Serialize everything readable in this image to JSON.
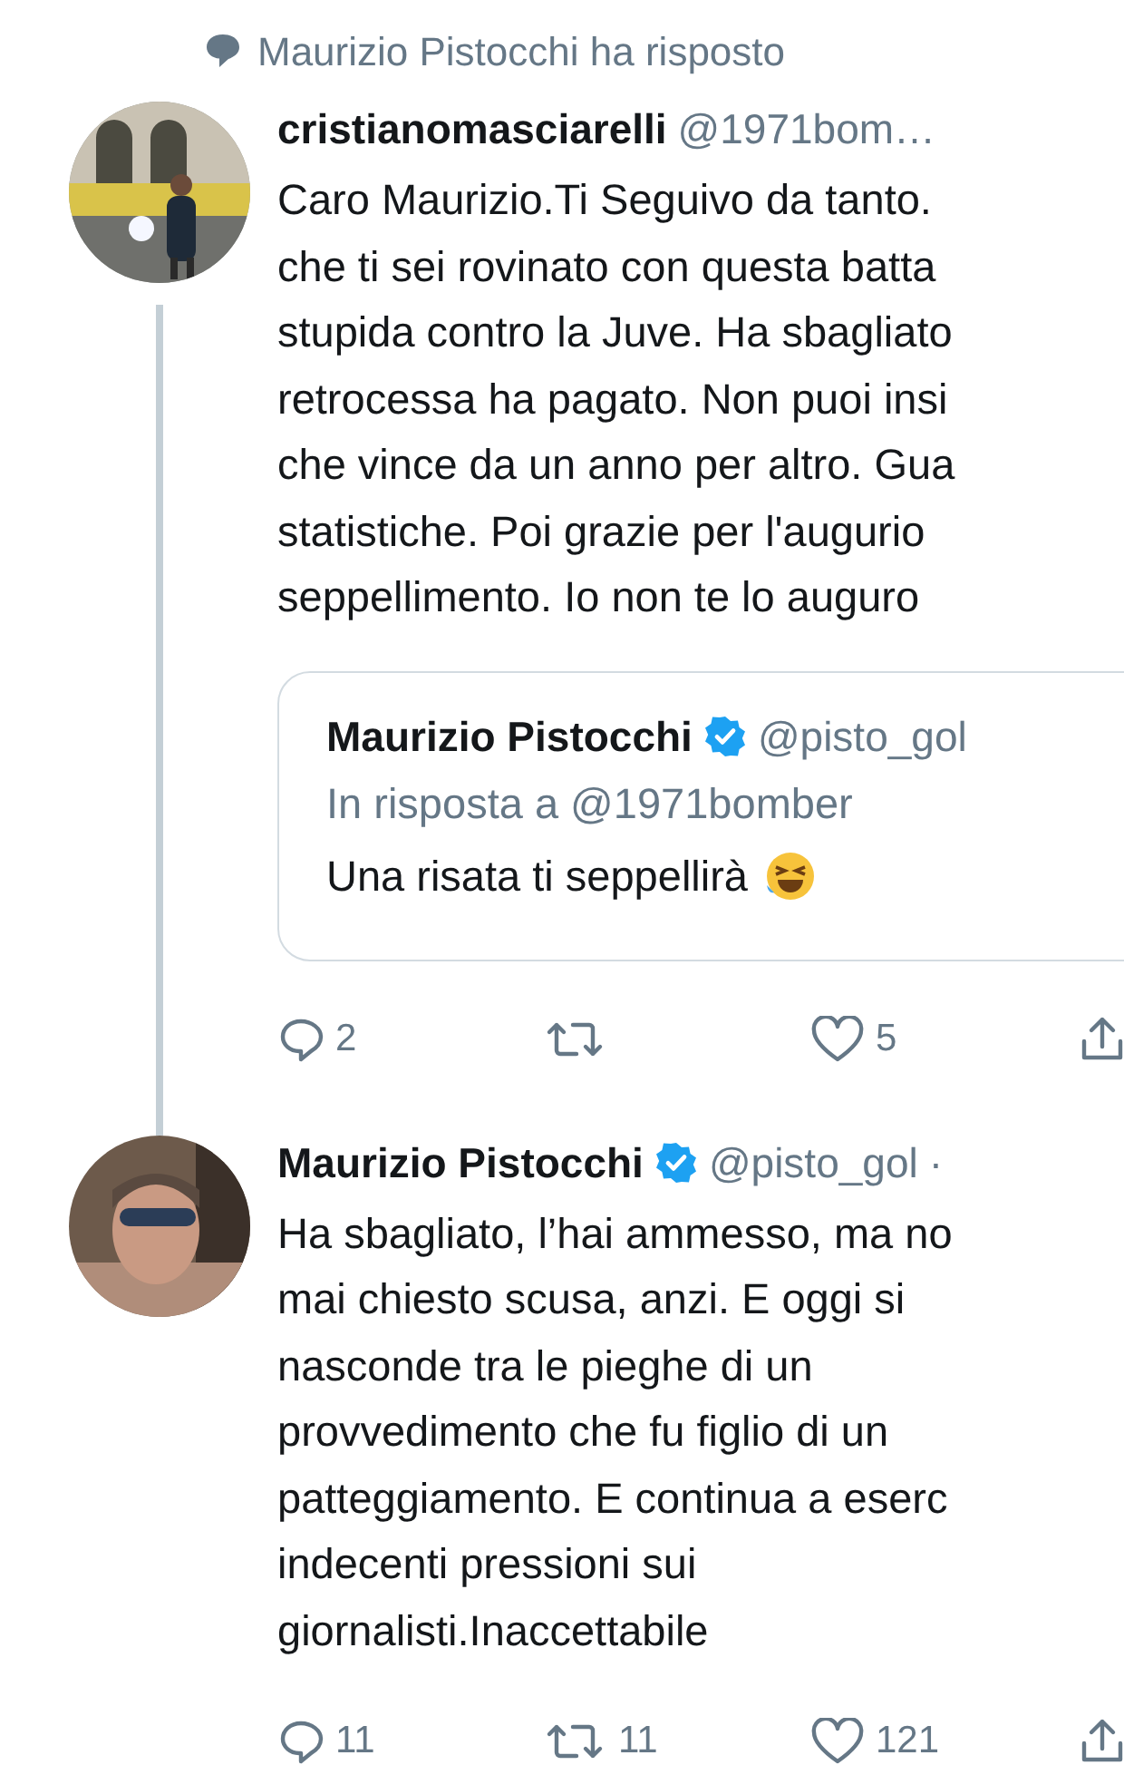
{
  "notification": {
    "text": "Maurizio Pistocchi ha risposto"
  },
  "tweets": [
    {
      "name": "cristianomasciarelli",
      "verified": false,
      "handle": "@1971bom…",
      "thread": true,
      "text": "Caro Maurizio.Ti Seguivo da tanto.\nche ti sei rovinato con questa batta\nstupida contro la Juve. Ha sbagliato\nretrocessa ha pagato. Non puoi insi\nche vince da un anno per altro. Gua\nstatistiche. Poi grazie per l'augurio\nseppellimento. Io non te lo auguro",
      "quote": {
        "name": "Maurizio Pistocchi",
        "verified": true,
        "handle": "@pisto_gol",
        "reply_to": "In risposta a @1971bomber",
        "text": "Una risata ti seppellirà"
      },
      "actions": [
        {
          "kind": "reply",
          "count": "2"
        },
        {
          "kind": "retweet"
        },
        {
          "kind": "like",
          "count": "5"
        },
        {
          "kind": "share"
        }
      ]
    },
    {
      "name": "Maurizio Pistocchi",
      "verified": true,
      "handle": "@pisto_gol",
      "separator": "·",
      "thread": false,
      "text": "Ha sbagliato, l’hai ammesso, ma no\nmai chiesto scusa, anzi. E oggi si\nnasconde tra le pieghe di un\nprovvedimento che fu figlio di un\npatteggiamento. E continua a eserc\nindecenti pressioni sui\ngiornalisti.Inaccettabile",
      "actions": [
        {
          "kind": "reply",
          "count": "11"
        },
        {
          "kind": "retweet",
          "count": "11"
        },
        {
          "kind": "like",
          "count": "121"
        },
        {
          "kind": "share"
        }
      ]
    }
  ]
}
